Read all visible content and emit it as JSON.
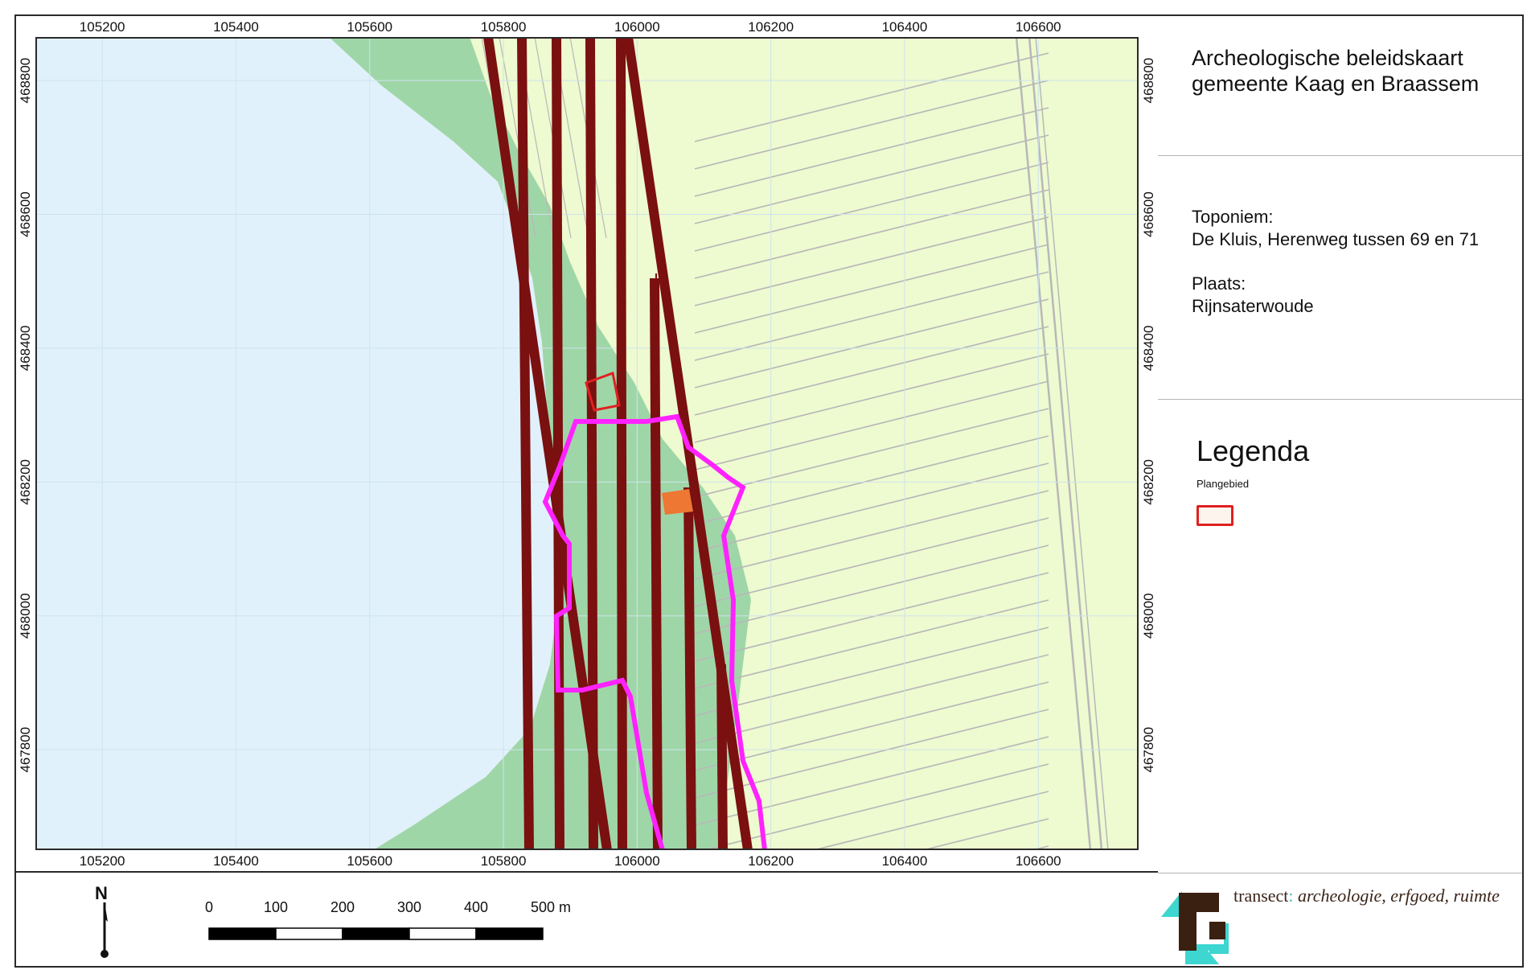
{
  "map": {
    "x_ticks": [
      "105200",
      "105400",
      "105600",
      "105800",
      "106000",
      "106200",
      "106400",
      "106600"
    ],
    "y_ticks": [
      "468800",
      "468600",
      "468400",
      "468200",
      "468000",
      "467800"
    ],
    "x_range": [
      105100,
      106750
    ],
    "y_range": [
      467650,
      468865
    ],
    "colors": {
      "water": "#e1f1fc",
      "land": "#eefad0",
      "embankment": "#9fd6a8",
      "road_lines": "#b8b8b8",
      "transect_lines": "#7a1010",
      "boundary": "#ff22ff",
      "plangebied": "#e02020",
      "marker": "#ee7733"
    }
  },
  "side": {
    "title_line1": "Archeologische beleidskaart",
    "title_line2": "gemeente Kaag en Braassem",
    "toponiem_label": "Toponiem:",
    "toponiem_value": "De Kluis, Herenweg tussen 69 en 71",
    "plaats_label": "Plaats:",
    "plaats_value": "Rijnsaterwoude",
    "legend_title": "Legenda",
    "legend_item": "Plangebied"
  },
  "scalebar": {
    "north": "N",
    "labels": [
      "0",
      "100",
      "200",
      "300",
      "400",
      "500 m"
    ]
  },
  "logo": {
    "name": "transect",
    "colon": ":",
    "tagline": "archeologie, erfgoed, ruimte",
    "colors": {
      "dark": "#3a2010",
      "cyan": "#3dd6d0"
    }
  }
}
